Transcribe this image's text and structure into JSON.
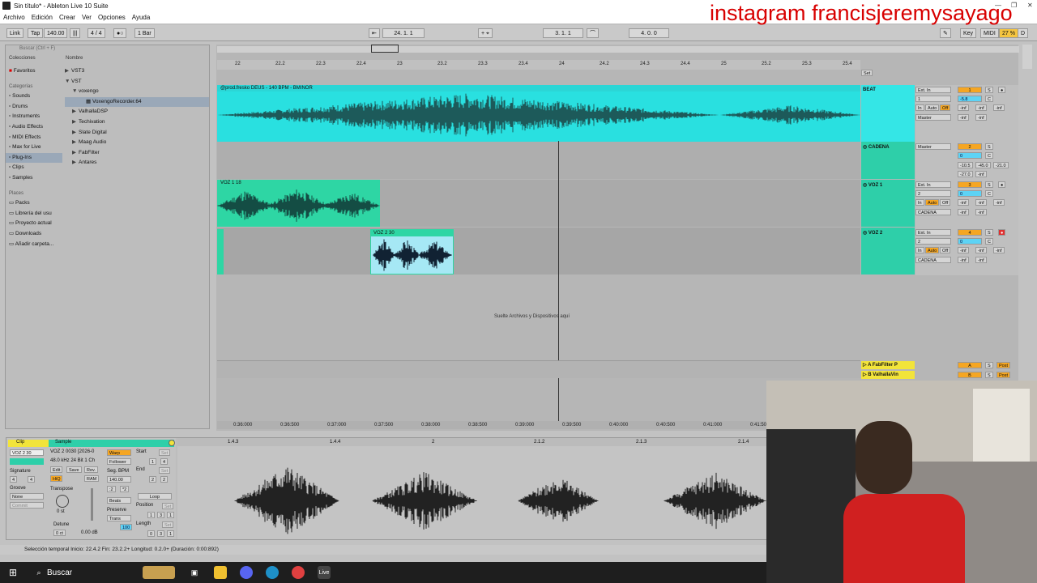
{
  "window": {
    "title": "Sin título* - Ableton Live 10 Suite"
  },
  "overlay_text": "instagram francisjeremysayago",
  "menu": [
    "Archivo",
    "Edición",
    "Crear",
    "Ver",
    "Opciones",
    "Ayuda"
  ],
  "control_bar": {
    "link": "Link",
    "tap": "Tap",
    "tempo": "140.00",
    "signature": "4 / 4",
    "quantize": "1 Bar",
    "position": "24. 1. 1",
    "loop_start": "3. 1. 1",
    "loop_length": "4. 0. 0",
    "key": "Key",
    "midi": "MIDI",
    "cpu": "27 %",
    "d": "D"
  },
  "browser": {
    "search_placeholder": "Buscar (Ctrl + F)",
    "collections_label": "Colecciones",
    "favorites": "Favoritos",
    "categories_label": "Categorías",
    "categories": [
      "Sounds",
      "Drums",
      "Instruments",
      "Audio Effects",
      "MIDI Effects",
      "Max for Live",
      "Plug-Ins",
      "Clips",
      "Samples"
    ],
    "places_label": "Places",
    "places": [
      "Packs",
      "Librería del usu",
      "Proyecto actual",
      "Downloads",
      "Añadir carpeta..."
    ],
    "name_header": "Nombre",
    "tree": [
      "VST3",
      "VST",
      "voxengo",
      "VoxengoRecorder.64",
      "ValhallaDSP",
      "Techivation",
      "Slate Digital",
      "Maag Audio",
      "FabFilter",
      "Antares"
    ]
  },
  "ruler": [
    "22",
    "22.2",
    "22.3",
    "22.4",
    "23",
    "23.2",
    "23.3",
    "23.4",
    "24",
    "24.2",
    "24.3",
    "24.4",
    "25",
    "25.2",
    "25.3",
    "25.4"
  ],
  "tracks": {
    "beat": {
      "clip": "@prod.fresko DEUS - 140 BPM - BMINOR",
      "name": "BEAT"
    },
    "cadena": {
      "name": "CADENA"
    },
    "voz1": {
      "clip": "VOZ 1 18",
      "name": "VOZ 1"
    },
    "voz2": {
      "clip": "VOZ 2 30",
      "name": "VOZ 2"
    }
  },
  "mixer": {
    "ext_in": "Ext. In",
    "master": "Master",
    "cadena_route": "CADENA",
    "in": "In",
    "auto": "Auto",
    "off": "Off",
    "inf": "-inf",
    "s": "S",
    "c": "C",
    "zero": "0",
    "beat_num": "1",
    "beat_vol": "-5.8",
    "cadena_num": "2",
    "cadena_vals": [
      "-10.5",
      "-45.0",
      "-21.0",
      "-27.0"
    ],
    "voz1_num": "3",
    "voz2_num": "4",
    "ret_a_num": "A",
    "ret_b_num": "B",
    "post": "Post",
    "set": "Set"
  },
  "drop_hint": "Suelte Archivos y Dispositivos aquí",
  "returns": [
    "A FabFilter P",
    "B ValhallaVin"
  ],
  "timebar": [
    "0:36:000",
    "0:36:500",
    "0:37:000",
    "0:37:500",
    "0:38:000",
    "0:38:500",
    "0:39:000",
    "0:39:500",
    "0:40:000",
    "0:40:500",
    "0:41:000",
    "0:41:500"
  ],
  "clip_view": {
    "clip_tab": "Clip",
    "sample_tab": "Sample",
    "clip_name": "VOZ 2 30",
    "file_name": "VOZ 2 0030 [2026-0",
    "file_info": "48.0 kHz 24 Bit 1 Ch",
    "edit": "Edit",
    "save": "Save",
    "rev": "Rev.",
    "warp": "Warp",
    "follower": "Follower",
    "seg_bpm_label": "Seg. BPM",
    "seg_bpm": "140.00",
    "hiq": "HiQ",
    "ram": "RAM",
    "signature_label": "Signature",
    "sig_num": "4",
    "sig_den": "4",
    "groove_label": "Groove",
    "groove_value": "None",
    "commit": "Commit",
    "transpose_label": "Transpose",
    "transpose_value": "0 st",
    "detune_label": "Detune",
    "detune_value": "0 ct",
    "gain": "0.00 dB",
    "beats": "Beats",
    "preserve": "Preserve",
    "trans": "Trans",
    "preserve_num": "100",
    "start_label": "Start",
    "end_label": "End",
    "loop_label": "Loop",
    "position_label": "Position",
    "length_label": "Length",
    "set": "Set",
    "start_vals": [
      "1",
      "4"
    ],
    "end_vals": [
      "2",
      "2"
    ],
    "pos_vals": [
      "1",
      "3",
      "1"
    ],
    "len_vals": [
      "0",
      "3",
      "1"
    ],
    "half": ":2",
    "double": "*2"
  },
  "detail_ruler": [
    "1.4.3",
    "1.4.4",
    "2",
    "2.1.2",
    "2.1.3",
    "2.1.4"
  ],
  "status": {
    "text": "Selección temporal  Inicio: 22.4.2  Fin: 23.2.2+  Longitud: 0.2.0+  (Duración: 0:00:892)"
  },
  "taskbar": {
    "search": "Buscar",
    "live": "Live"
  }
}
